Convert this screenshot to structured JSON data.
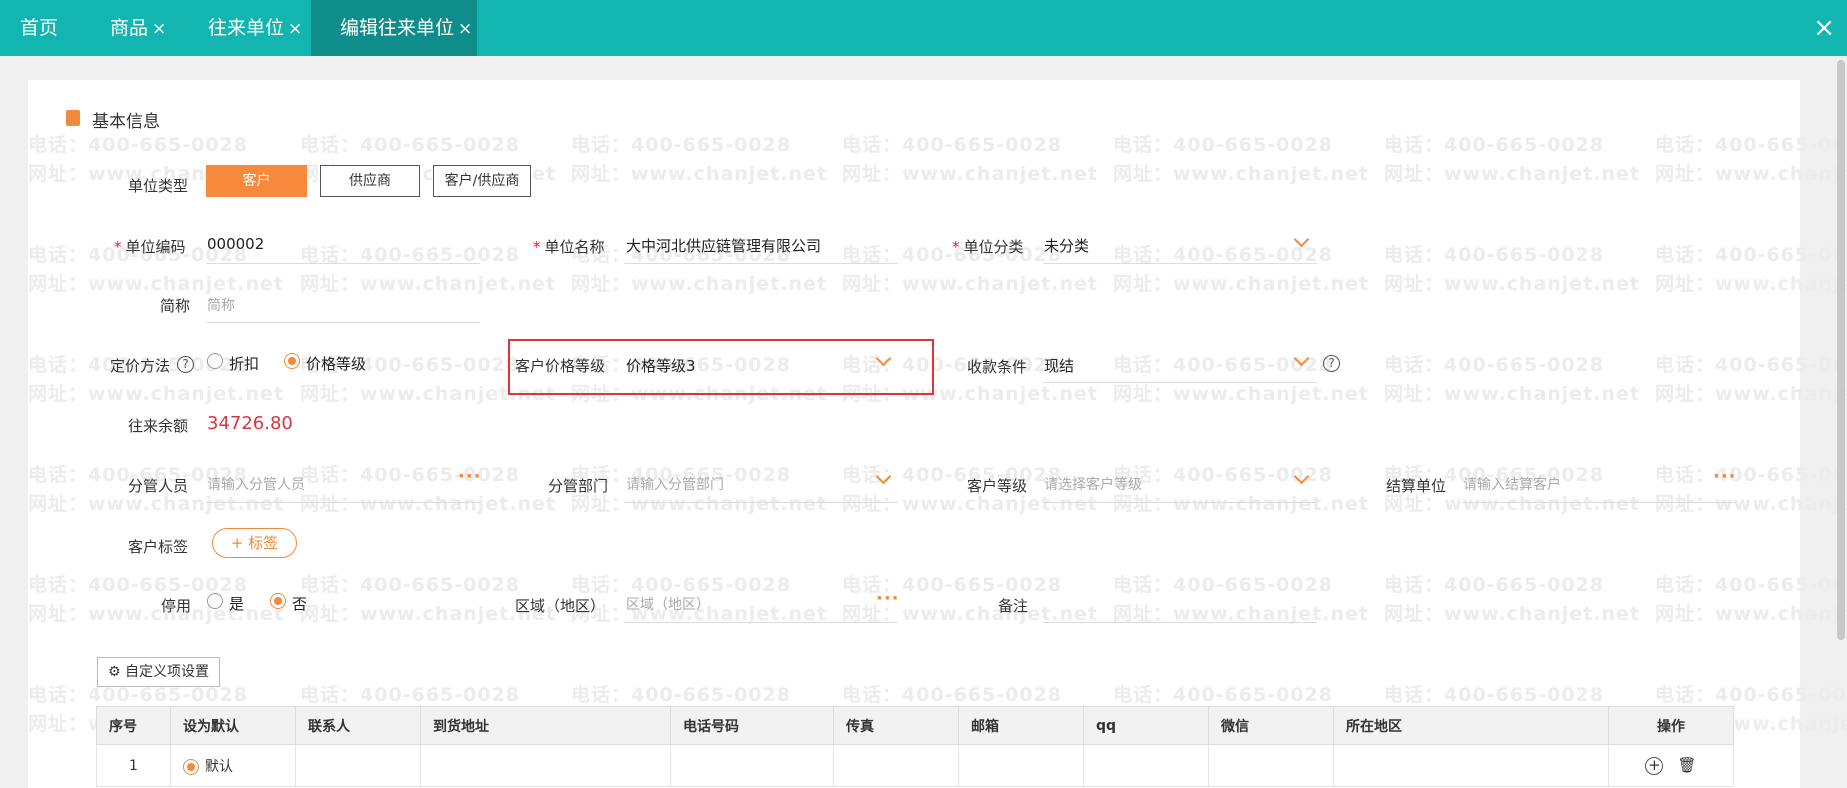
{
  "tabs": [
    {
      "label": "首页",
      "closable": false
    },
    {
      "label": "商品",
      "closable": true
    },
    {
      "label": "往来单位",
      "closable": true
    },
    {
      "label": "编辑往来单位",
      "closable": true,
      "active": true
    }
  ],
  "close_glyph": "×",
  "watermark": {
    "phone": "电话：400-665-0028",
    "site": "网址：www.chanjet.net"
  },
  "section_title": "基本信息",
  "unit_type": {
    "label": "单位类型",
    "options": [
      "客户",
      "供应商",
      "客户/供应商"
    ],
    "selected": "客户"
  },
  "unit_code": {
    "label": "单位编码",
    "value": "000002"
  },
  "unit_name": {
    "label": "单位名称",
    "value": "大中河北供应链管理有限公司"
  },
  "unit_category": {
    "label": "单位分类",
    "value": "未分类"
  },
  "short_name": {
    "label": "简称",
    "placeholder": "简称"
  },
  "pricing_method": {
    "label": "定价方法",
    "options": [
      "折扣",
      "价格等级"
    ],
    "selected": "价格等级"
  },
  "customer_price_level": {
    "label": "客户价格等级",
    "value": "价格等级3"
  },
  "payment_terms": {
    "label": "收款条件",
    "value": "现结"
  },
  "balance": {
    "label": "往来余额",
    "value": "34726.80"
  },
  "manager": {
    "label": "分管人员",
    "placeholder": "请输入分管人员"
  },
  "department": {
    "label": "分管部门",
    "placeholder": "请输入分管部门"
  },
  "customer_level": {
    "label": "客户等级",
    "placeholder": "请选择客户等级"
  },
  "settle_unit": {
    "label": "结算单位",
    "placeholder": "请输入结算客户"
  },
  "customer_tag": {
    "label": "客户标签",
    "button": "+ 标签"
  },
  "disabled": {
    "label": "停用",
    "options": [
      "是",
      "否"
    ],
    "selected": "否"
  },
  "region": {
    "label": "区域（地区）",
    "placeholder": "区域（地区）"
  },
  "remark": {
    "label": "备注"
  },
  "custom_settings_button": "自定义项设置",
  "table": {
    "headers": [
      "序号",
      "设为默认",
      "联系人",
      "到货地址",
      "电话号码",
      "传真",
      "邮箱",
      "qq",
      "微信",
      "所在地区",
      "操作"
    ],
    "rows": [
      {
        "index": "1",
        "default_label": "默认"
      }
    ]
  },
  "colors": {
    "header": "#13b5b1",
    "accent": "#f6893b",
    "highlight": "#d9363e"
  },
  "icons": {
    "section": "document-icon",
    "help": "question-icon",
    "settings": "gear-icon",
    "add": "plus-circle-icon",
    "delete": "trash-icon"
  }
}
